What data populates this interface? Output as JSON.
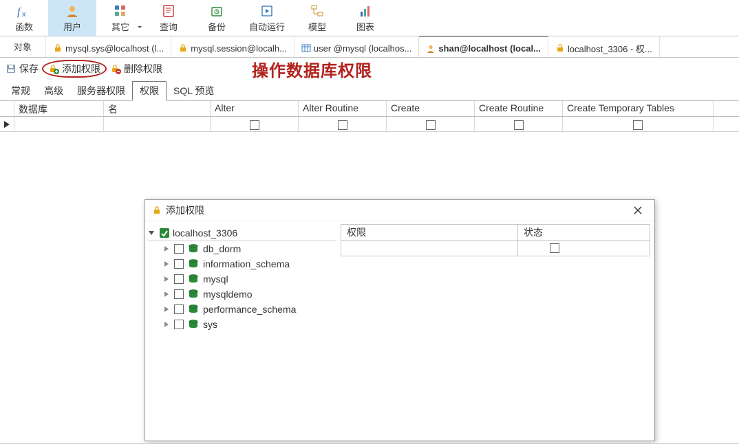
{
  "ribbon": [
    {
      "label": "函数",
      "icon": "fx"
    },
    {
      "label": "用户",
      "icon": "user",
      "active": true
    },
    {
      "label": "其它",
      "icon": "other",
      "dropdown": true
    },
    {
      "label": "查询",
      "icon": "query"
    },
    {
      "label": "备份",
      "icon": "backup"
    },
    {
      "label": "自动运行",
      "icon": "auto"
    },
    {
      "label": "模型",
      "icon": "model"
    },
    {
      "label": "图表",
      "icon": "chart"
    }
  ],
  "tabs": {
    "object_label": "对象",
    "docs": [
      {
        "label": "mysql.sys@localhost (l...",
        "icon": "lock"
      },
      {
        "label": "mysql.session@localh...",
        "icon": "lock"
      },
      {
        "label": "user @mysql (localhos...",
        "icon": "table"
      },
      {
        "label": "shan@localhost (local...",
        "icon": "user",
        "active": true,
        "bold": true
      },
      {
        "label": "localhost_3306 - 权...",
        "icon": "lock-o"
      }
    ]
  },
  "actions": {
    "save": "保存",
    "add_priv": "添加权限",
    "del_priv": "删除权限"
  },
  "heading": "操作数据库权限",
  "subtabs": [
    "常规",
    "高级",
    "服务器权限",
    "权限",
    "SQL 预览"
  ],
  "active_subtab": 3,
  "grid": {
    "columns": [
      "数据库",
      "名",
      "Alter",
      "Alter Routine",
      "Create",
      "Create Routine",
      "Create Temporary Tables"
    ],
    "widths": [
      130,
      155,
      128,
      128,
      128,
      128,
      219
    ],
    "row_checks": [
      null,
      null,
      false,
      false,
      false,
      false,
      false
    ]
  },
  "dialog": {
    "title": "添加权限",
    "connection": "localhost_3306",
    "databases": [
      "db_dorm",
      "information_schema",
      "mysql",
      "mysqldemo",
      "performance_schema",
      "sys"
    ],
    "right_cols": [
      "权限",
      "状态"
    ]
  }
}
